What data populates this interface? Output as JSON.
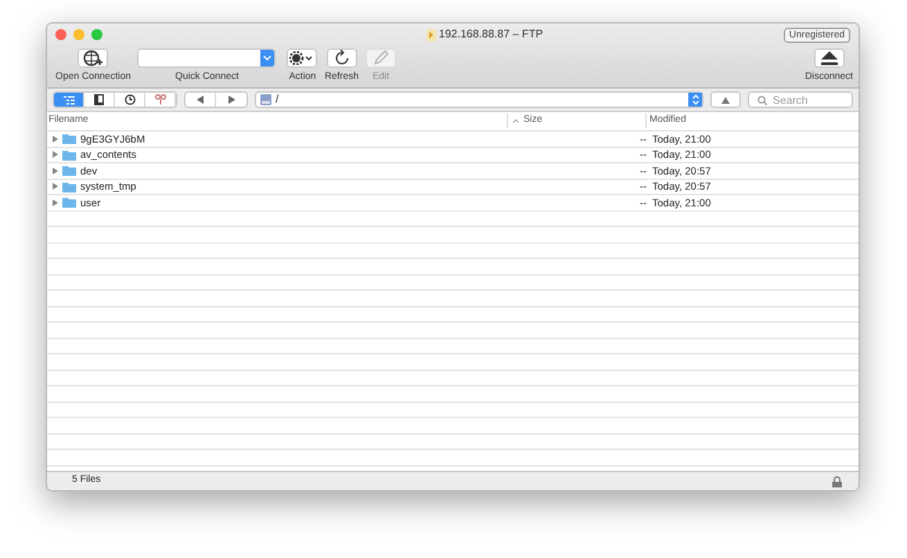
{
  "window": {
    "title": "192.168.88.87 – FTP",
    "badge": "Unregistered"
  },
  "toolbar": [
    {
      "kind": "icon",
      "label": "Open Connection",
      "disabled": false
    },
    {
      "kind": "combo",
      "label": "Quick Connect",
      "disabled": false
    },
    {
      "kind": "action",
      "label": "Action",
      "disabled": false
    },
    {
      "kind": "refresh",
      "label": "Refresh",
      "disabled": false
    },
    {
      "kind": "edit",
      "label": "Edit",
      "disabled": true
    },
    {
      "kind": "eject",
      "label": "Disconnect",
      "disabled": false
    }
  ],
  "view_modes": [
    {
      "selected": true
    },
    {
      "selected": false
    },
    {
      "selected": false
    },
    {
      "selected": false
    }
  ],
  "path": "/",
  "search": {
    "placeholder": "Search"
  },
  "table": {
    "columns": [
      "Filename",
      "Size",
      "Modified"
    ],
    "rows": [
      {
        "name": "9gE3GYJ6bM",
        "size": "--",
        "modified": "Today, 21:00"
      },
      {
        "name": "av_contents",
        "size": "--",
        "modified": "Today, 21:00"
      },
      {
        "name": "dev",
        "size": "--",
        "modified": "Today, 20:57"
      },
      {
        "name": "system_tmp",
        "size": "--",
        "modified": "Today, 20:57"
      },
      {
        "name": "user",
        "size": "--",
        "modified": "Today, 21:00"
      }
    ]
  },
  "status_bar": "5 Files"
}
